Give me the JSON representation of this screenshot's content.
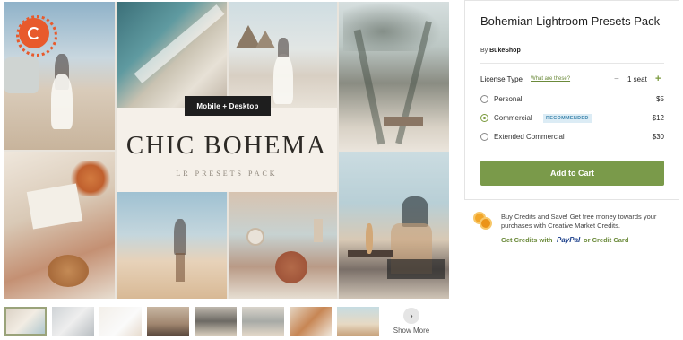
{
  "preview": {
    "badge": "Mobile + Desktop",
    "title": "CHIC BOHEMA",
    "subtitle": "LR PRESETS PACK",
    "brand_icon": "creative-market-logo-icon"
  },
  "thumbnails": {
    "count": 9,
    "show_more_label": "Show More",
    "show_more_icon": "chevron-right-icon"
  },
  "product": {
    "title": "Bohemian Lightroom Presets Pack",
    "by_prefix": "By",
    "seller": "BukeShop"
  },
  "license": {
    "label": "License Type",
    "help_link": "What are these?",
    "qty_minus": "−",
    "qty_value": "1 seat",
    "qty_plus": "+",
    "options": [
      {
        "label": "Personal",
        "price": "$5",
        "checked": false
      },
      {
        "label": "Commercial",
        "price": "$12",
        "checked": true,
        "badge": "RECOMMENDED"
      },
      {
        "label": "Extended Commercial",
        "price": "$30",
        "checked": false
      }
    ]
  },
  "cart": {
    "add_label": "Add to Cart",
    "accent": "#7a9a4a"
  },
  "credits": {
    "text": "Buy Credits and Save! Get free money towards your purchases with Creative Market Credits.",
    "link": "Get Credits with",
    "paypal": "PayPal",
    "tail": "or Credit Card",
    "icon": "coins-icon"
  }
}
